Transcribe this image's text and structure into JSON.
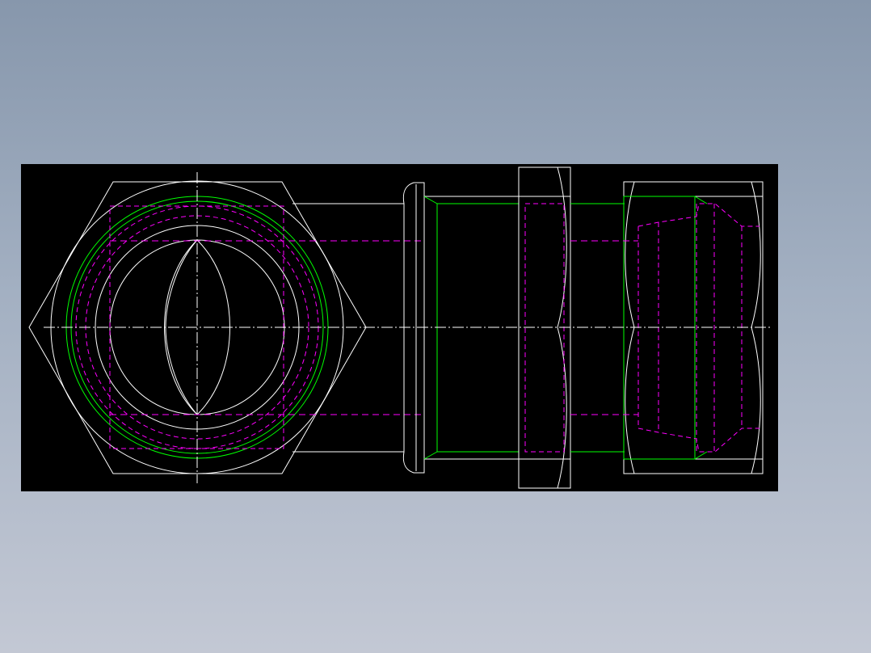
{
  "drawing": {
    "canvas_color": "#000000",
    "outline_color": "#ffffff",
    "thread_color": "#00ff00",
    "hidden_line_color": "#ff00ff",
    "centerline_color": "#ffffff",
    "views": [
      "front-view-hex-fitting",
      "side-view-fitting-body"
    ]
  }
}
